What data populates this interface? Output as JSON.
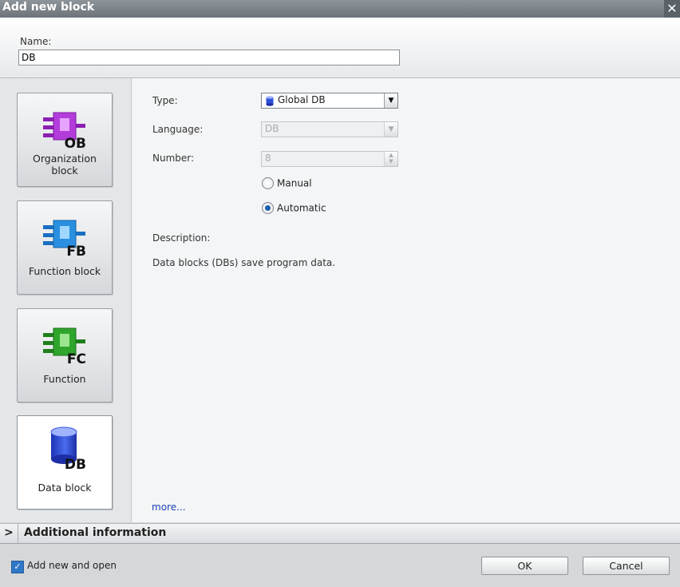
{
  "window": {
    "title": "Add new block",
    "close_glyph": "✕"
  },
  "name_field": {
    "label": "Name:",
    "value": "DB"
  },
  "block_types": [
    {
      "label": "Organization block",
      "badge": "OB",
      "color": "#b23ddb"
    },
    {
      "label": "Function block",
      "badge": "FB",
      "color": "#2a8fe0"
    },
    {
      "label": "Function",
      "badge": "FC",
      "color": "#2fa52c"
    },
    {
      "label": "Data block",
      "badge": "DB",
      "color": "#2c4fd8",
      "selected": true
    }
  ],
  "form": {
    "type_label": "Type:",
    "type_value": "Global DB",
    "language_label": "Language:",
    "language_value": "DB",
    "number_label": "Number:",
    "number_value": "8",
    "radio_manual": "Manual",
    "radio_automatic": "Automatic",
    "radio_selected": "Automatic",
    "description_label": "Description:",
    "description_text": "Data blocks (DBs) save program data.",
    "more_link": "more..."
  },
  "additional_info": {
    "label": "Additional information",
    "arrow": ">"
  },
  "footer": {
    "add_open_label": "Add new and open",
    "add_open_checked": true,
    "ok_label": "OK",
    "cancel_label": "Cancel"
  }
}
